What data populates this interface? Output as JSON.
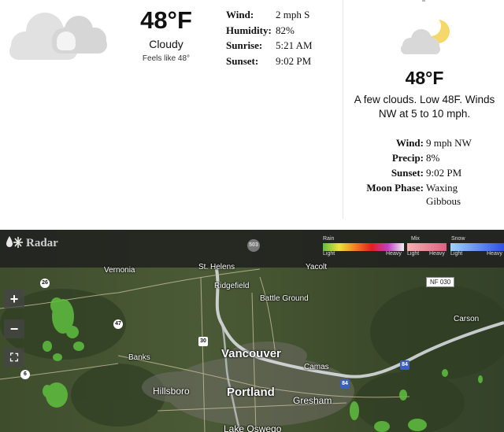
{
  "current": {
    "icon": "cloudy-icon",
    "temperature": "48°F",
    "condition": "Cloudy",
    "feels_like": "Feels like 48°",
    "details": [
      {
        "label": "Wind:",
        "value": "2 mph S"
      },
      {
        "label": "Humidity:",
        "value": "82%"
      },
      {
        "label": "Sunrise:",
        "value": "5:21 AM"
      },
      {
        "label": "Sunset:",
        "value": "9:02 PM"
      }
    ]
  },
  "tonight": {
    "icon": "partly-cloudy-night-icon",
    "temperature": "48°F",
    "description": "A few clouds. Low 48F. Winds NW at 5 to 10 mph.",
    "details": [
      {
        "label": "Wind:",
        "value": "9 mph NW"
      },
      {
        "label": "Precip:",
        "value": "8%"
      },
      {
        "label": "Sunset:",
        "value": "9:02 PM"
      },
      {
        "label": "Moon Phase:",
        "value": "Waxing Gibbous"
      }
    ]
  },
  "radar": {
    "title": "Radar",
    "legend": {
      "rain": "Rain",
      "mix": "Mix",
      "snow": "Snow",
      "light": "Light",
      "heavy": "Heavy"
    },
    "zoom_in": "+",
    "zoom_out": "−",
    "fullscreen": "⛶",
    "cities": {
      "vernonia": "Vernonia",
      "st_helens": "St. Helens",
      "yacolt": "Yacolt",
      "ridgefield": "Ridgefield",
      "battle_ground": "Battle Ground",
      "carson": "Carson",
      "banks": "Banks",
      "vancouver": "Vancouver",
      "camas": "Camas",
      "hillsboro": "Hillsboro",
      "portland": "Portland",
      "gresham": "Gresham",
      "lake_oswego": "Lake Oswego"
    },
    "route_labels": {
      "r26": "26",
      "r47": "47",
      "r30": "30",
      "r6": "6",
      "i84a": "84",
      "i84b": "84",
      "r503": "503"
    },
    "nf_tag": "NF 030"
  }
}
